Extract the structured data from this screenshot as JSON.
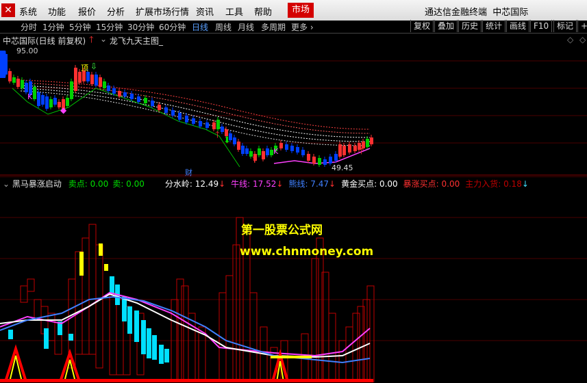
{
  "menu": {
    "items": [
      "系统",
      "功能",
      "报价",
      "分析",
      "扩展市场行情",
      "资讯",
      "工具",
      "帮助"
    ],
    "market": "市场",
    "brand": "通达信金融终端",
    "stock_name": "中芯国际"
  },
  "toolbar": {
    "periods": [
      "分时",
      "1分钟",
      "5分钟",
      "15分钟",
      "30分钟",
      "60分钟",
      "日线",
      "周线",
      "月线",
      "多周期",
      "更多"
    ],
    "active_period": "日线",
    "right_buttons": [
      "复权",
      "叠加",
      "历史",
      "统计",
      "画线",
      "F10",
      "标记",
      "+"
    ]
  },
  "main_chart": {
    "title": "中芯国际(日线 前复权)",
    "indicator_name": "龙飞九天主图_",
    "high_label": "95.00",
    "low_label": "49.45",
    "marker_top": "顶",
    "marker_k": "K",
    "marker_cai": "财"
  },
  "sub_chart": {
    "name": "黑马暴涨启动",
    "values": [
      {
        "label": "卖点:",
        "value": "0.00",
        "color": "#00e000"
      },
      {
        "label": "卖:",
        "value": "0.00",
        "color": "#00e000"
      },
      {
        "label": "分水岭:",
        "value": "12.49",
        "color": "#ffffff",
        "arrow": "down",
        "arrow_color": "#ff3030"
      },
      {
        "label": "牛线:",
        "value": "17.52",
        "color": "#ff40ff",
        "arrow": "down",
        "arrow_color": "#ff3030"
      },
      {
        "label": "熊线:",
        "value": "7.47",
        "color": "#4080ff",
        "arrow": "down",
        "arrow_color": "#ff3030"
      },
      {
        "label": "黄金买点:",
        "value": "0.00",
        "color": "#ffffff"
      },
      {
        "label": "暴涨买点:",
        "value": "0.00",
        "color": "#ff3030"
      },
      {
        "label": "主力入货:",
        "value": "0.18",
        "color": "#c00000",
        "arrow": "down",
        "arrow_color": "#40e0ff"
      }
    ]
  },
  "watermark": {
    "line1": "第一股票公式网",
    "line2": "www.chnmoney.com"
  },
  "colors": {
    "up": "#ff3030",
    "down": "#0040ff",
    "flat_green": "#00d000",
    "cyan": "#00e0ff",
    "magenta": "#ff40ff",
    "yellow": "#ffff00",
    "watermark": "#ffff00"
  }
}
